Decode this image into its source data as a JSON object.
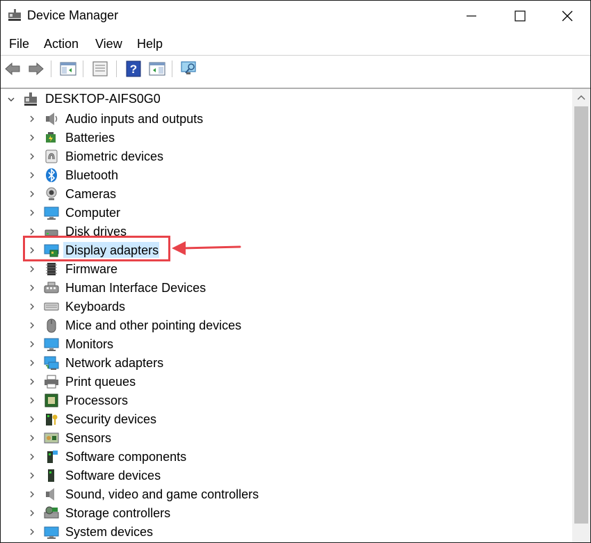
{
  "window": {
    "title": "Device Manager",
    "menu": [
      "File",
      "Action",
      "View",
      "Help"
    ]
  },
  "tree": {
    "root": "DESKTOP-AIFS0G0",
    "categories": [
      {
        "label": "Audio inputs and outputs",
        "icon": "speaker-icon"
      },
      {
        "label": "Batteries",
        "icon": "battery-icon"
      },
      {
        "label": "Biometric devices",
        "icon": "fingerprint-icon"
      },
      {
        "label": "Bluetooth",
        "icon": "bluetooth-icon"
      },
      {
        "label": "Cameras",
        "icon": "camera-icon"
      },
      {
        "label": "Computer",
        "icon": "computer-icon"
      },
      {
        "label": "Disk drives",
        "icon": "disk-drive-icon"
      },
      {
        "label": "Display adapters",
        "icon": "display-adapter-icon",
        "selected": true
      },
      {
        "label": "Firmware",
        "icon": "firmware-icon"
      },
      {
        "label": "Human Interface Devices",
        "icon": "hid-icon"
      },
      {
        "label": "Keyboards",
        "icon": "keyboard-icon"
      },
      {
        "label": "Mice and other pointing devices",
        "icon": "mouse-icon"
      },
      {
        "label": "Monitors",
        "icon": "monitor-icon"
      },
      {
        "label": "Network adapters",
        "icon": "network-adapter-icon"
      },
      {
        "label": "Print queues",
        "icon": "printer-icon"
      },
      {
        "label": "Processors",
        "icon": "processor-icon"
      },
      {
        "label": "Security devices",
        "icon": "security-device-icon"
      },
      {
        "label": "Sensors",
        "icon": "sensor-icon"
      },
      {
        "label": "Software components",
        "icon": "software-component-icon"
      },
      {
        "label": "Software devices",
        "icon": "software-device-icon"
      },
      {
        "label": "Sound, video and game controllers",
        "icon": "sound-controller-icon"
      },
      {
        "label": "Storage controllers",
        "icon": "storage-controller-icon"
      },
      {
        "label": "System devices",
        "icon": "system-device-icon"
      }
    ]
  },
  "colors": {
    "selection": "#cce8ff",
    "annotation": "#e8434a"
  }
}
